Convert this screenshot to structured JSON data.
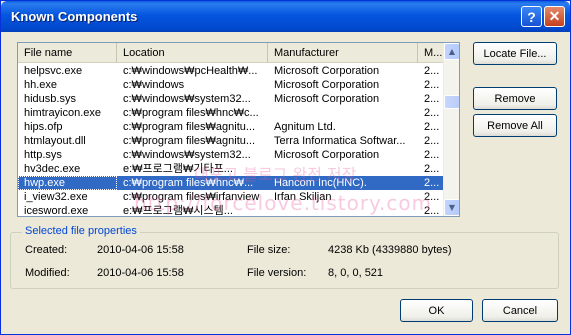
{
  "window": {
    "title": "Known Components",
    "help_label": "?",
    "close_label": "✕"
  },
  "list": {
    "columns": [
      "File name",
      "Location",
      "Manufacturer",
      "M..."
    ],
    "rows": [
      [
        "helpsvc.exe",
        "c:₩windows₩pcHealth₩...",
        "Microsoft Corporation",
        "2..."
      ],
      [
        "hh.exe",
        "c:₩windows",
        "Microsoft Corporation",
        "2..."
      ],
      [
        "hidusb.sys",
        "c:₩windows₩system32...",
        "Microsoft Corporation",
        "2..."
      ],
      [
        "himtrayicon.exe",
        "c:₩program files₩hnc₩c...",
        "",
        "2..."
      ],
      [
        "hips.ofp",
        "c:₩program files₩agnitu...",
        "Agnitum Ltd.",
        "2..."
      ],
      [
        "htmlayout.dll",
        "c:₩program files₩agnitu...",
        "Terra Informatica Softwar...",
        "2..."
      ],
      [
        "http.sys",
        "c:₩windows₩system32...",
        "Microsoft Corporation",
        "2..."
      ],
      [
        "hv3dec.exe",
        "e:₩프로그램₩기타프...",
        "",
        "2..."
      ],
      [
        "hwp.exe",
        "c:₩program files₩hnc₩...",
        "Hancom Inc(HNC).",
        "2..."
      ],
      [
        "i_view32.exe",
        "c:₩program files₩irfanview",
        "Irfan Skiljan",
        "2..."
      ],
      [
        "icesword.exe",
        "e:₩프로그램₩시스템...",
        "",
        "2..."
      ]
    ],
    "selected_index": 8
  },
  "scrollbar": {
    "up_icon": "▲",
    "down_icon": "▼"
  },
  "buttons": {
    "locate": "Locate File...",
    "remove": "Remove",
    "remove_all": "Remove All",
    "ok": "OK",
    "cancel": "Cancel"
  },
  "selected_props": {
    "group_title": "Selected file properties",
    "created_label": "Created:",
    "created_value": "2010-04-06 15:58",
    "modified_label": "Modified:",
    "modified_value": "2010-04-06 15:58",
    "size_label": "File size:",
    "size_value": "4238 Kb (4339880 bytes)",
    "version_label": "File version:",
    "version_value": "8, 0, 0, 521"
  },
  "watermark": {
    "line1": "대포고 블로그 완전 저장",
    "line2": "http://forcelove.tistory.com"
  },
  "colors": {
    "title_bar": "#0054e3",
    "selection": "#316ac5",
    "group_title": "#0046d5",
    "watermark": "#e65aa0"
  }
}
